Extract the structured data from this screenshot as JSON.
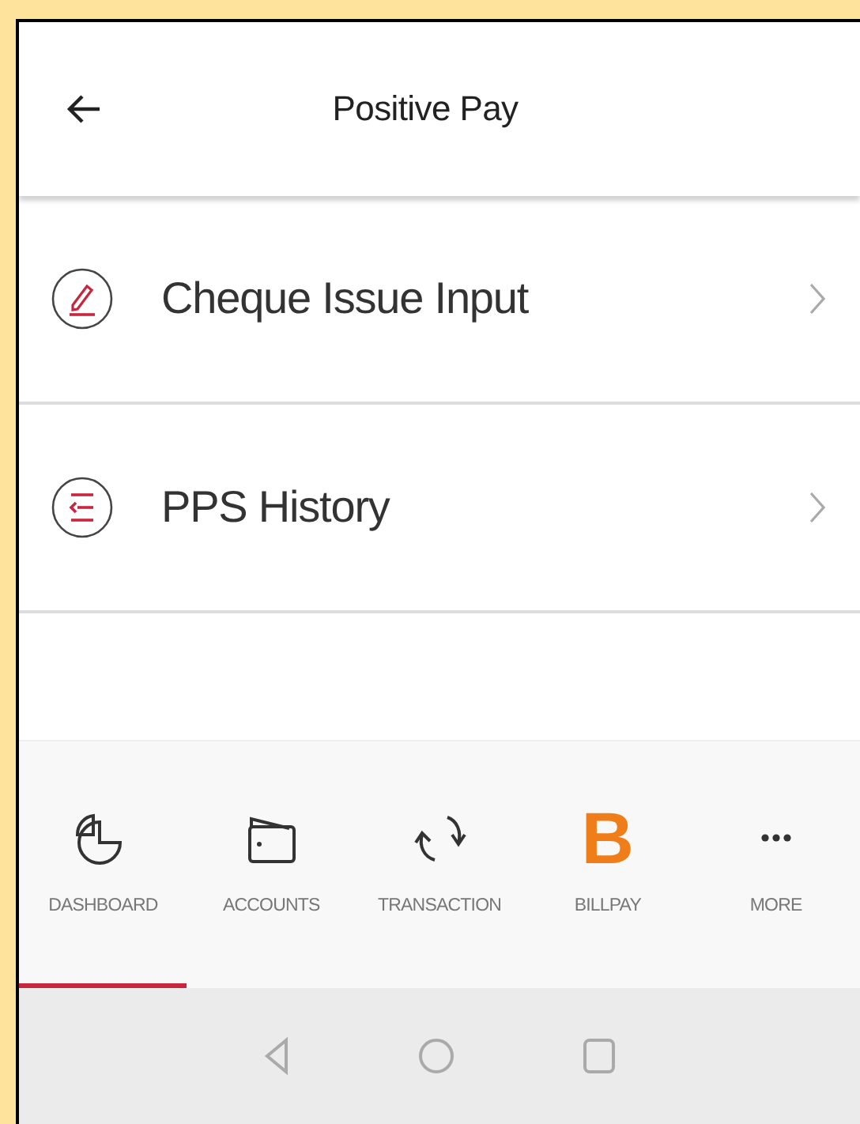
{
  "header": {
    "title": "Positive Pay"
  },
  "menu": [
    {
      "kind": "pencil",
      "label": "Cheque Issue Input"
    },
    {
      "kind": "history",
      "label": "PPS History"
    }
  ],
  "bottom_nav": [
    {
      "kind": "dashboard",
      "label": "DASHBOARD",
      "selected": true
    },
    {
      "kind": "accounts",
      "label": "ACCOUNTS",
      "selected": false
    },
    {
      "kind": "transaction",
      "label": "TRANSACTION",
      "selected": false
    },
    {
      "kind": "billpay",
      "label": "BILLPAY",
      "logo": "B",
      "selected": false
    },
    {
      "kind": "more",
      "label": "MORE",
      "selected": false
    }
  ]
}
